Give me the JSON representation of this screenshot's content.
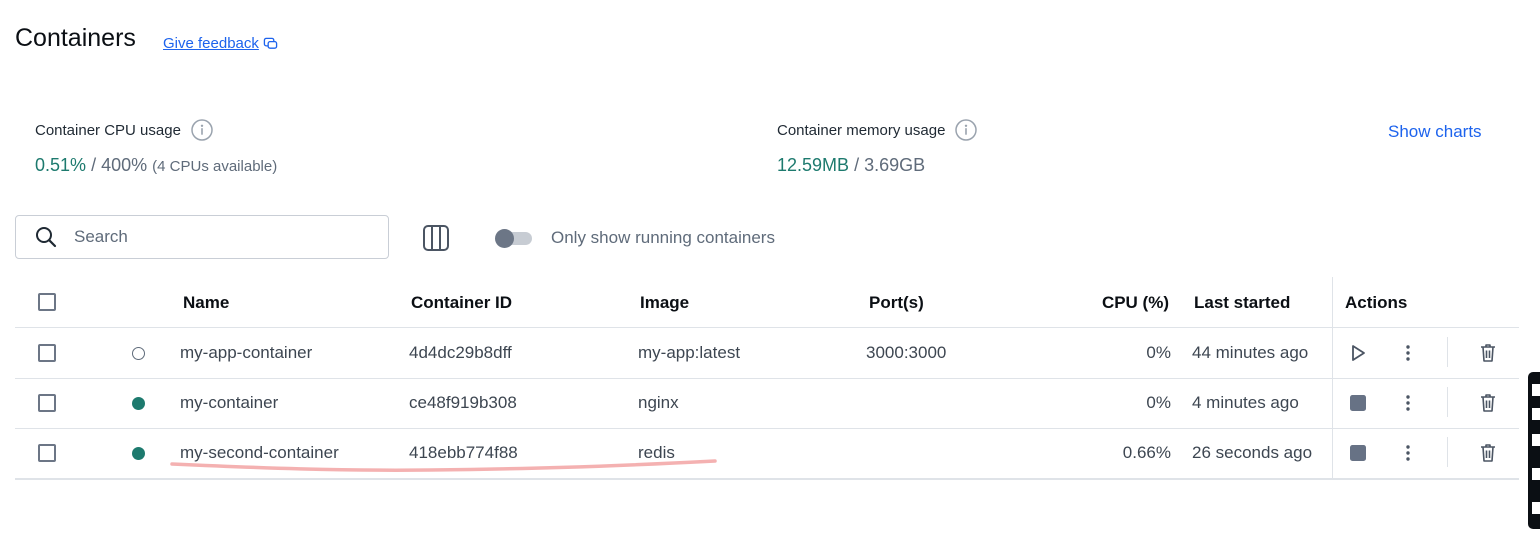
{
  "header": {
    "title": "Containers",
    "feedback_label": "Give feedback"
  },
  "stats": {
    "cpu": {
      "label": "Container CPU usage",
      "used": "0.51%",
      "separator": "/",
      "total": "400%",
      "note": "(4 CPUs available)"
    },
    "memory": {
      "label": "Container memory usage",
      "used": "12.59MB",
      "separator": "/",
      "total": "3.69GB"
    },
    "show_charts_label": "Show charts"
  },
  "toolbar": {
    "search_placeholder": "Search",
    "toggle_label": "Only show running containers",
    "toggle_on": false
  },
  "table": {
    "columns": {
      "name": "Name",
      "container_id": "Container ID",
      "image": "Image",
      "ports": "Port(s)",
      "cpu": "CPU (%)",
      "last_started": "Last started",
      "actions": "Actions"
    },
    "rows": [
      {
        "status": "stopped",
        "name": "my-app-container",
        "container_id": "4d4dc29b8dff",
        "image": "my-app:latest",
        "ports": "3000:3000",
        "cpu": "0%",
        "last_started": "44 minutes ago",
        "primary_action": "start"
      },
      {
        "status": "running",
        "name": "my-container",
        "container_id": "ce48f919b308",
        "image": "nginx",
        "ports": "",
        "cpu": "0%",
        "last_started": "4 minutes ago",
        "primary_action": "stop"
      },
      {
        "status": "running",
        "name": "my-second-container",
        "container_id": "418ebb774f88",
        "image": "redis",
        "ports": "",
        "cpu": "0.66%",
        "last_started": "26 seconds ago",
        "primary_action": "stop"
      }
    ]
  },
  "colors": {
    "accent": "#1d63ed",
    "running": "#1d7a6e",
    "annotation": "#f2a3a3"
  }
}
